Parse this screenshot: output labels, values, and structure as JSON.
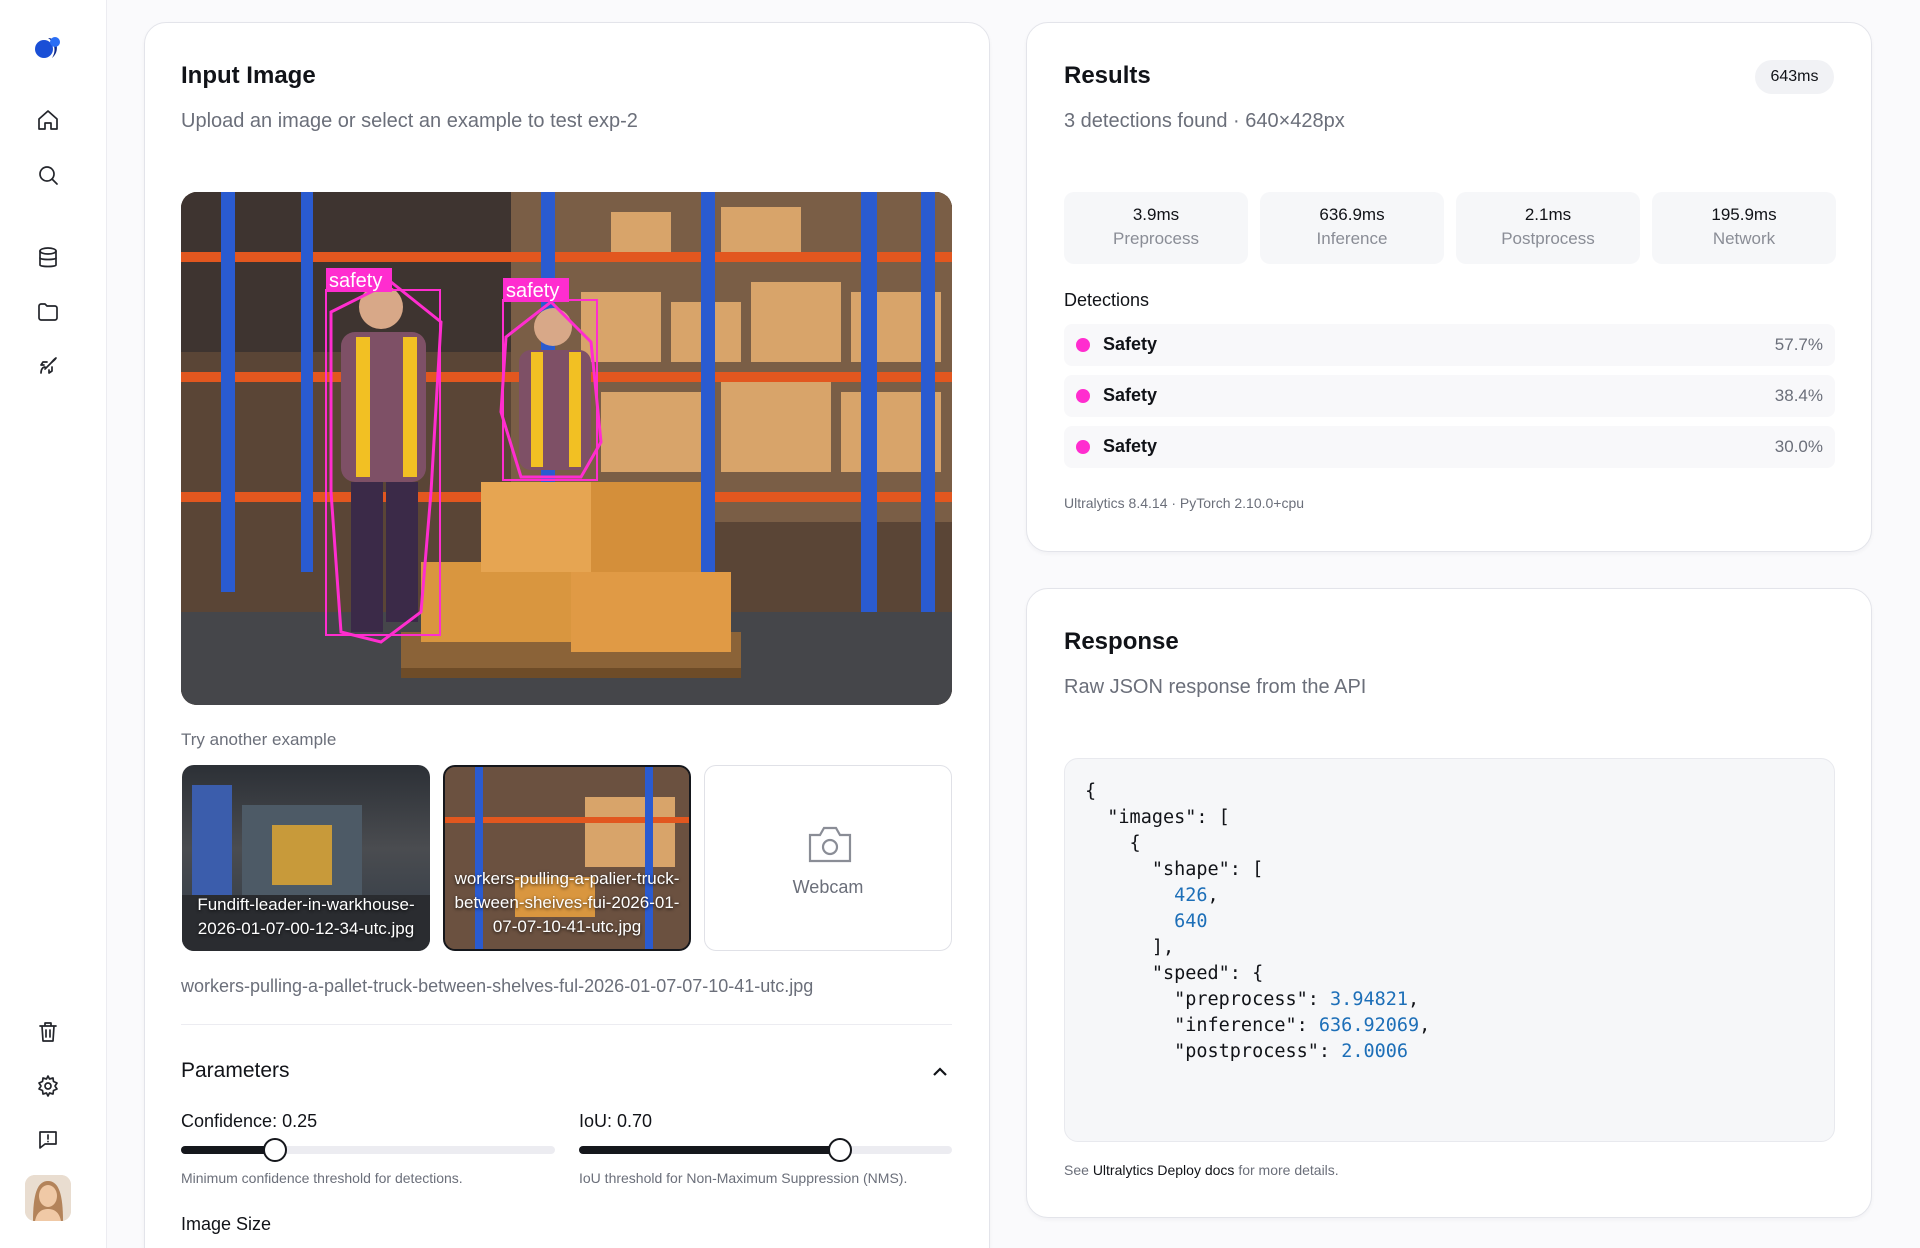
{
  "sidebar": {
    "items": [
      "home-icon",
      "search-icon",
      "database-icon",
      "folder-icon",
      "rocket-icon",
      "trash-icon",
      "gear-icon",
      "feedback-icon"
    ]
  },
  "input_card": {
    "title": "Input Image",
    "subtitle": "Upload an image or select an example to test exp-2",
    "image": {
      "detections": [
        {
          "label": "safety"
        },
        {
          "label": "safety"
        }
      ]
    },
    "examples_label": "Try another example",
    "examples": [
      {
        "caption": "Fundift-leader-in-warkhouse-2026-01-07-00-12-34-utc.jpg"
      },
      {
        "caption": "workers-pulling-a-palier-truck-between-sheives-fui-2026-01-07-07-10-41-utc.jpg"
      }
    ],
    "webcam_label": "Webcam",
    "selected_filename": "workers-pulling-a-pallet-truck-between-shelves-ful-2026-01-07-07-10-41-utc.jpg",
    "parameters_title": "Parameters",
    "confidence": {
      "label": "Confidence: 0.25",
      "value": 0.25,
      "help": "Minimum confidence threshold for detections."
    },
    "iou": {
      "label": "IoU: 0.70",
      "value": 0.7,
      "help": "IoU threshold for Non-Maximum Suppression (NMS)."
    },
    "image_size_label": "Image Size"
  },
  "results_card": {
    "title": "Results",
    "badge": "643ms",
    "subtitle": "3 detections found · 640×428px",
    "metrics": [
      {
        "value": "3.9ms",
        "label": "Preprocess"
      },
      {
        "value": "636.9ms",
        "label": "Inference"
      },
      {
        "value": "2.1ms",
        "label": "Postprocess"
      },
      {
        "value": "195.9ms",
        "label": "Network"
      }
    ],
    "detections_title": "Detections",
    "detections": [
      {
        "name": "Safety",
        "confidence": "57.7%"
      },
      {
        "name": "Safety",
        "confidence": "38.4%"
      },
      {
        "name": "Safety",
        "confidence": "30.0%"
      }
    ],
    "version": "Ultralytics 8.4.14 · PyTorch 2.10.0+cpu",
    "detection_color": "#ff2dcf"
  },
  "response_card": {
    "title": "Response",
    "subtitle": "Raw JSON response from the API",
    "code_lines": [
      "{",
      "  \"images\": [",
      "    {",
      "      \"shape\": [",
      "        426,",
      "        640",
      "      ],",
      "      \"speed\": {",
      "        \"preprocess\": 3.94821,",
      "        \"inference\": 636.92069,",
      "        \"postprocess\": 2.0006"
    ],
    "footer_prefix": "See",
    "footer_link": "Ultralytics Deploy docs",
    "footer_suffix": "for more details."
  }
}
